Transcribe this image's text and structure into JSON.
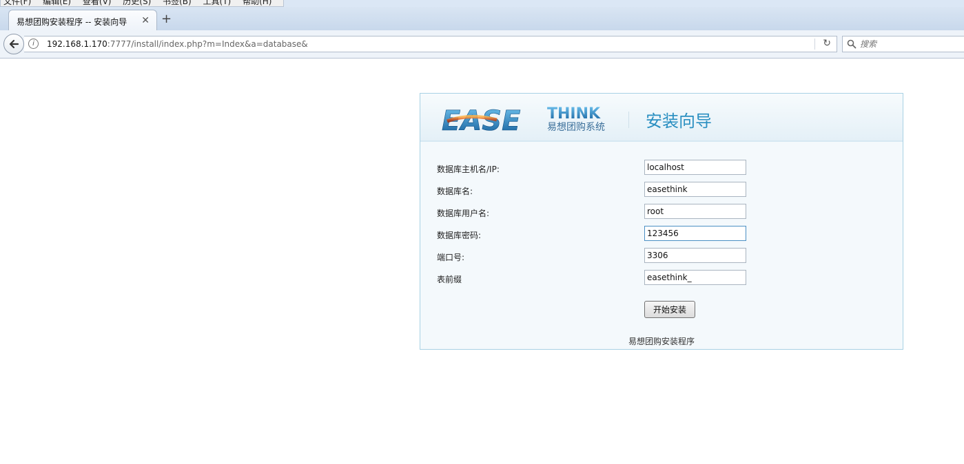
{
  "browser": {
    "menu": [
      "文件(F)",
      "编辑(E)",
      "查看(V)",
      "历史(S)",
      "书签(B)",
      "工具(T)",
      "帮助(H)"
    ],
    "tab": {
      "title": "易想团购安装程序 -- 安装向导",
      "close": "✕"
    },
    "new_tab": "+",
    "back": "🡐",
    "url": {
      "host": "192.168.1.170",
      "rest": ":7777/install/index.php?m=Index&a=database&"
    },
    "reload": "↻",
    "search": {
      "placeholder": "搜索"
    }
  },
  "install": {
    "logo": {
      "brand_main": "EASE",
      "brand_accent": "THINK",
      "tagline": "易想团购系统"
    },
    "title": "安装向导",
    "fields": [
      {
        "label": "数据库主机名/IP:",
        "value": "localhost"
      },
      {
        "label": "数据库名:",
        "value": "easethink"
      },
      {
        "label": "数据库用户名:",
        "value": "root"
      },
      {
        "label": "数据库密码:",
        "value": "123456"
      },
      {
        "label": "端口号:",
        "value": "3306"
      },
      {
        "label": "表前缀",
        "value": "easethink_"
      }
    ],
    "button": "开始安装",
    "footer": "易想团购安装程序"
  },
  "colors": {
    "accent": "#2a8fc1",
    "logo_orange": "#e2581c",
    "logo_blue": "#1a76b8",
    "panel_border": "#a8d1e4"
  }
}
